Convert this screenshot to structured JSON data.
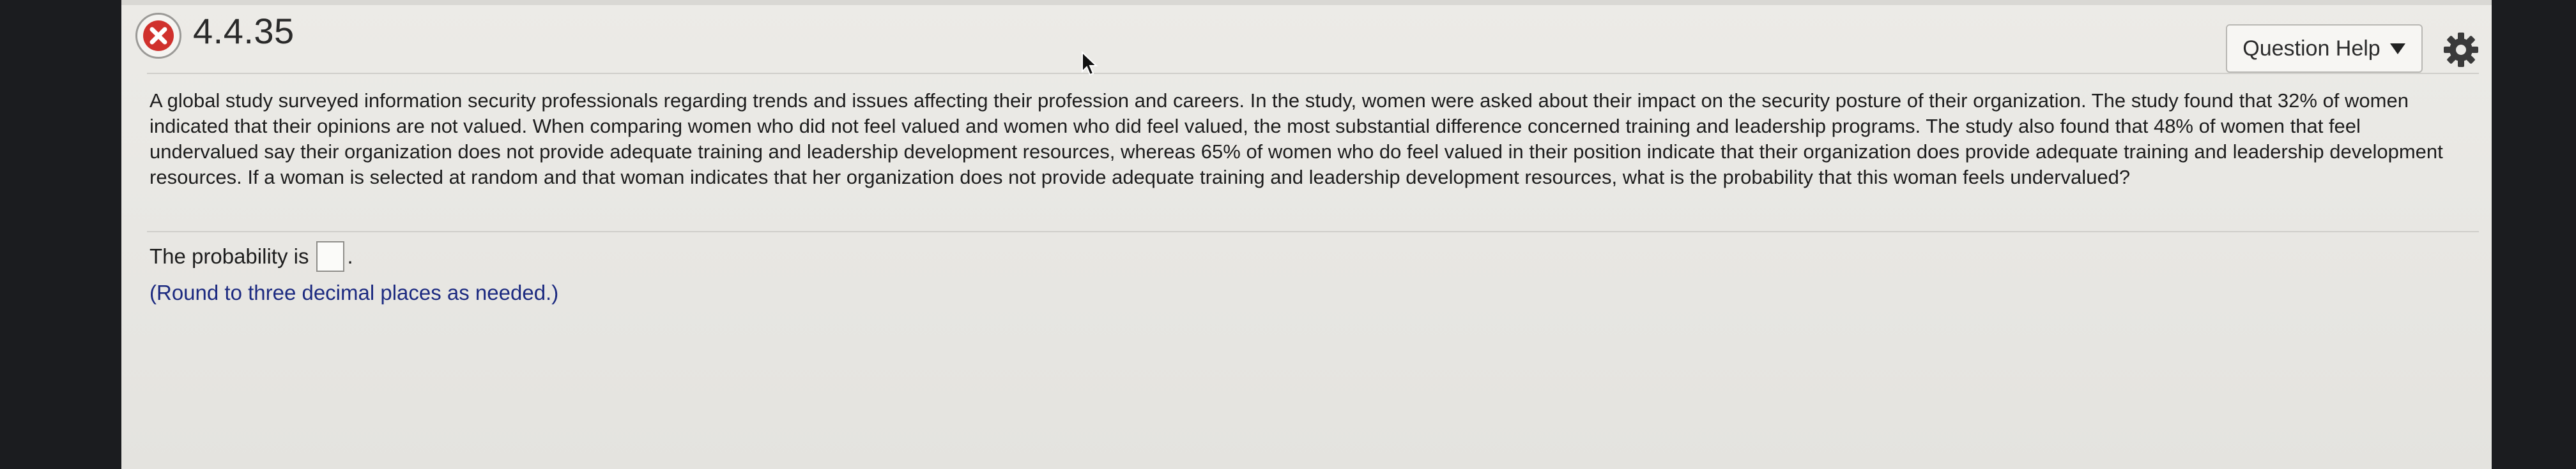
{
  "header": {
    "question_number": "4.4.35",
    "status_icon": "incorrect-x-icon",
    "help_button_label": "Question Help",
    "settings_icon": "gear-icon"
  },
  "question": {
    "text": "A global study surveyed information security professionals regarding trends and issues affecting their profession and careers. In the study, women were asked about their impact on the security posture of their organization. The study found that 32% of women indicated that their opinions are not valued. When comparing women who did not feel valued and women who did feel valued, the most substantial difference concerned training and leadership programs. The study also found that 48% of women that feel undervalued say their organization does not provide adequate training and leadership development resources, whereas 65% of women who do feel valued in their position indicate that their organization does provide adequate training and leadership development resources. If a woman is selected at random and that woman indicates that her organization does not provide adequate training and leadership development resources, what is the probability that this woman feels undervalued?"
  },
  "answer": {
    "prefix": "The probability is",
    "value": "",
    "suffix": ".",
    "hint": "(Round to three decimal places as needed.)"
  },
  "colors": {
    "status_red": "#d0312d",
    "hint_blue": "#1c2a80",
    "background": "#ebeae6"
  }
}
